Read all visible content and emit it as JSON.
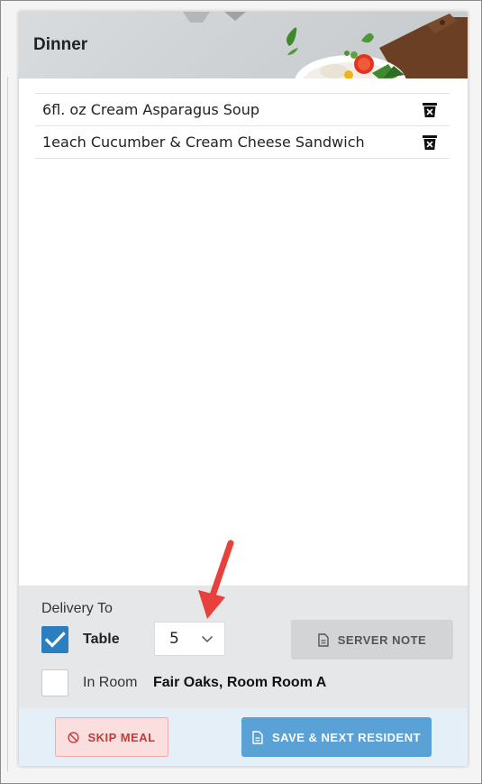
{
  "meal": {
    "title": "Dinner",
    "items": [
      {
        "label": "6fl. oz Cream Asparagus Soup"
      },
      {
        "label": "1each Cucumber & Cream Cheese Sandwich"
      }
    ]
  },
  "delivery": {
    "label": "Delivery To",
    "table": {
      "label": "Table",
      "checked": true,
      "value": "5"
    },
    "room": {
      "label": "In Room",
      "checked": false,
      "value": "Fair Oaks, Room Room A"
    }
  },
  "buttons": {
    "server_note": "SERVER NOTE",
    "skip_meal": "SKIP MEAL",
    "save_next": "SAVE & NEXT RESIDENT"
  },
  "colors": {
    "accent": "#2a7fc1",
    "save_button": "#5aa2d6",
    "skip_button_bg": "#fbdede",
    "skip_button_text": "#c23b3b",
    "annotation_arrow": "#e8403a"
  },
  "icons": {
    "delete": "trash-icon",
    "note": "document-icon",
    "skip": "no-entry-icon",
    "select": "chevron-down-icon",
    "checkbox": "checkmark-icon"
  }
}
